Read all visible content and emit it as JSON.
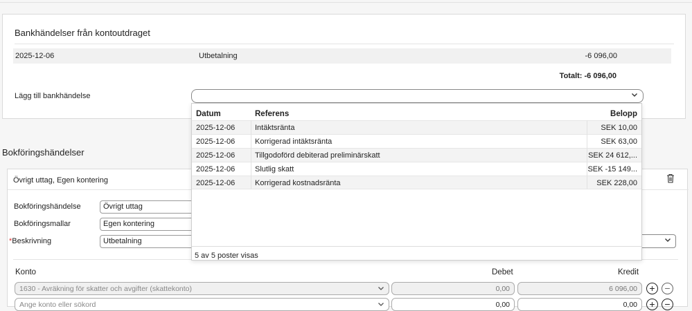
{
  "bank": {
    "title": "Bankhändelser från kontoutdraget",
    "row": {
      "date": "2025-12-06",
      "text": "Utbetalning",
      "amount": "-6 096,00"
    },
    "total": "Totalt: -6 096,00",
    "add_label": "Lägg till bankhändelse",
    "add_chevron": "chevron-down-icon"
  },
  "dropdown": {
    "headers": {
      "date": "Datum",
      "ref": "Referens",
      "amount": "Belopp"
    },
    "rows": [
      {
        "date": "2025-12-06",
        "ref": "Intäktsränta",
        "amount": "SEK 10,00"
      },
      {
        "date": "2025-12-06",
        "ref": "Korrigerad intäktsränta",
        "amount": "SEK 63,00"
      },
      {
        "date": "2025-12-06",
        "ref": "Tillgodoförd debiterad preliminärskatt",
        "amount": "SEK 24 612,..."
      },
      {
        "date": "2025-12-06",
        "ref": "Slutlig skatt",
        "amount": "SEK -15 149..."
      },
      {
        "date": "2025-12-06",
        "ref": "Korrigerad kostnadsränta",
        "amount": "SEK 228,00"
      }
    ],
    "footer": "5 av 5 poster visas"
  },
  "booking": {
    "section_title": "Bokföringshändelser",
    "card_title": "Övrigt uttag, Egen kontering",
    "fields": {
      "event_label": "Bokföringshändelse",
      "event_value": "Övrigt uttag",
      "template_label": "Bokföringsmallar",
      "template_value": "Egen kontering",
      "desc_required": "*",
      "desc_label": "Beskrivning",
      "desc_value": "Utbetalning"
    },
    "columns": {
      "konto": "Konto",
      "debet": "Debet",
      "kredit": "Kredit"
    },
    "rows": [
      {
        "account": "1630 - Avräkning för skatter och avgifter (skattekonto)",
        "debet": "0,00",
        "kredit": "6 096,00"
      },
      {
        "account": "Ange konto eller sökord",
        "debet": "0,00",
        "kredit": "0,00"
      }
    ]
  }
}
